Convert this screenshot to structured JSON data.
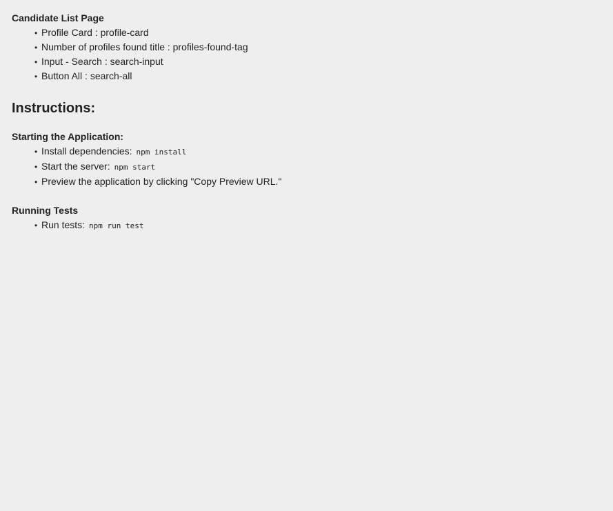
{
  "candidate_section": {
    "title": "Candidate List Page",
    "items": [
      "Profile Card : profile-card",
      "Number of profiles found title : profiles-found-tag",
      "Input - Search : search-input",
      "Button All : search-all"
    ]
  },
  "instructions": {
    "title": "Instructions:"
  },
  "starting_section": {
    "title": "Starting the Application:",
    "items": [
      {
        "text": "Install dependencies:",
        "code": "npm install"
      },
      {
        "text": "Start the server:",
        "code": "npm start"
      },
      {
        "text": "Preview the application by clicking \"Copy Preview URL.\""
      }
    ]
  },
  "tests_section": {
    "title": "Running Tests",
    "items": [
      {
        "text": "Run tests:",
        "code": "npm run test"
      }
    ]
  }
}
